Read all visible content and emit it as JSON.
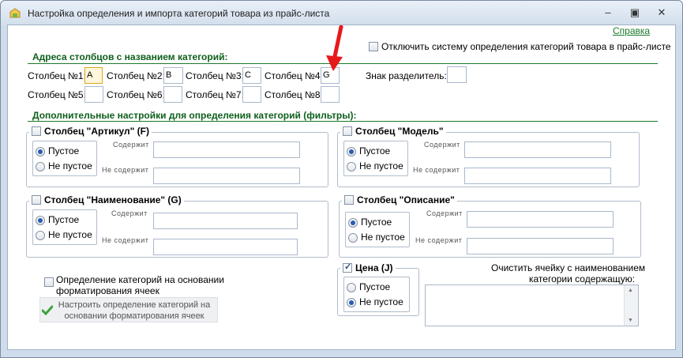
{
  "window": {
    "title": "Настройка определения и импорта категорий товара из прайс-листа"
  },
  "help_link": "Справка",
  "disable_system": {
    "label": "Отключить систему определения категорий товара в прайс-листе",
    "checked": false
  },
  "addresses": {
    "title": "Адреса столбцов с названием категорий:",
    "columns": [
      {
        "label": "Столбец №1:",
        "value": "A"
      },
      {
        "label": "Столбец №2:",
        "value": "B"
      },
      {
        "label": "Столбец №3:",
        "value": "C"
      },
      {
        "label": "Столбец №4:",
        "value": "G"
      },
      {
        "label": "Столбец №5:",
        "value": ""
      },
      {
        "label": "Столбец №6:",
        "value": ""
      },
      {
        "label": "Столбец №7:",
        "value": ""
      },
      {
        "label": "Столбец №8:",
        "value": ""
      }
    ],
    "separator_label": "Знак разделитель:",
    "separator_value": ""
  },
  "filters": {
    "title": "Дополнительные настройки для определения категорий (фильтры):",
    "contains_label": "Содержит",
    "not_contains_label": "Не содержит",
    "empty_label": "Пустое",
    "not_empty_label": "Не пустое",
    "groups": [
      {
        "title": "Столбец \"Артикул\" (F)",
        "checked": false,
        "selected": "empty",
        "contains": "",
        "not_contains": ""
      },
      {
        "title": "Столбец \"Модель\"",
        "checked": false,
        "selected": "empty",
        "contains": "",
        "not_contains": ""
      },
      {
        "title": "Столбец \"Наименование\" (G)",
        "checked": false,
        "selected": "empty",
        "contains": "",
        "not_contains": ""
      },
      {
        "title": "Столбец \"Описание\"",
        "checked": false,
        "selected": "empty",
        "contains": "",
        "not_contains": ""
      }
    ],
    "price": {
      "title": "Цена (J)",
      "checked": true,
      "selected": "not_empty"
    }
  },
  "format_detect": {
    "label_line1": "Определение категорий на основании",
    "label_line2": "форматирования ячеек",
    "checked": false,
    "button_line1": "Настроить определение категорий на",
    "button_line2": "основании форматирования ячеек"
  },
  "clear_cell": {
    "label_line1": "Очистить ячейку с наименованием",
    "label_line2": "категории содержащую:",
    "value": ""
  },
  "colors": {
    "section_green": "#0d5f1b",
    "arrow_red": "#e8191b"
  }
}
